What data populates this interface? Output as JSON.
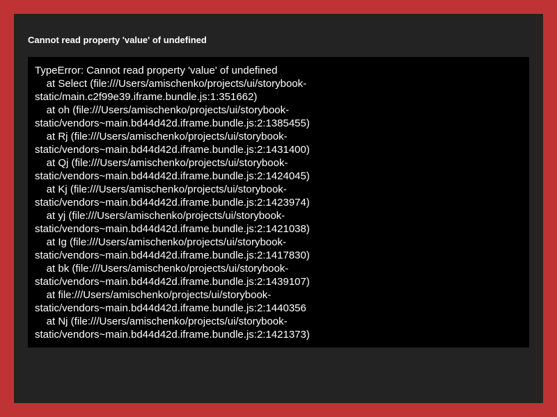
{
  "colors": {
    "outer_border": "#c03334",
    "panel_background": "#232323",
    "stack_background": "#000000",
    "text": "#ffffff"
  },
  "error": {
    "title": "Cannot read property 'value' of undefined",
    "stack": [
      "TypeError: Cannot read property 'value' of undefined",
      "    at Select (file:///Users/amischenko/projects/ui/storybook-",
      "static/main.c2f99e39.iframe.bundle.js:1:351662)",
      "    at oh (file:///Users/amischenko/projects/ui/storybook-",
      "static/vendors~main.bd44d42d.iframe.bundle.js:2:1385455)",
      "    at Rj (file:///Users/amischenko/projects/ui/storybook-",
      "static/vendors~main.bd44d42d.iframe.bundle.js:2:1431400)",
      "    at Qj (file:///Users/amischenko/projects/ui/storybook-",
      "static/vendors~main.bd44d42d.iframe.bundle.js:2:1424045)",
      "    at Kj (file:///Users/amischenko/projects/ui/storybook-",
      "static/vendors~main.bd44d42d.iframe.bundle.js:2:1423974)",
      "    at yj (file:///Users/amischenko/projects/ui/storybook-",
      "static/vendors~main.bd44d42d.iframe.bundle.js:2:1421038)",
      "    at Ig (file:///Users/amischenko/projects/ui/storybook-",
      "static/vendors~main.bd44d42d.iframe.bundle.js:2:1417830)",
      "    at bk (file:///Users/amischenko/projects/ui/storybook-",
      "static/vendors~main.bd44d42d.iframe.bundle.js:2:1439107)",
      "    at file:///Users/amischenko/projects/ui/storybook-",
      "static/vendors~main.bd44d42d.iframe.bundle.js:2:1440356",
      "    at Nj (file:///Users/amischenko/projects/ui/storybook-",
      "static/vendors~main.bd44d42d.iframe.bundle.js:2:1421373)"
    ]
  }
}
